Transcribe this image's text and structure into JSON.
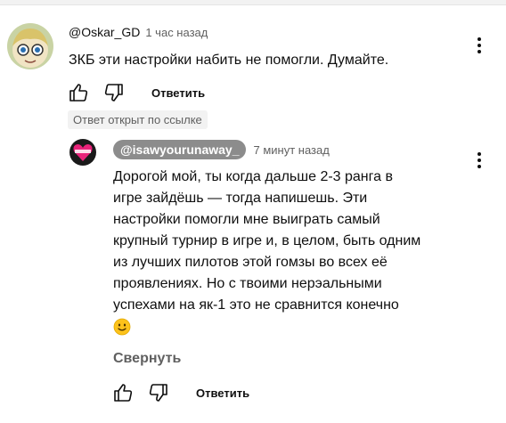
{
  "comment": {
    "author": "@Oskar_GD",
    "time": "1 час назад",
    "text": "ЗКБ эти настройки набить не помогли. Думайте.",
    "reply_label": "Ответить",
    "badge": "Ответ открыт по ссылке"
  },
  "reply": {
    "author": "@isawyourunaway_",
    "time": "7 минут назад",
    "lines": [
      "Дорогой мой, ты когда дальше 2-3 ранга в",
      "игре зайдёшь — тогда напишешь. Эти",
      "настройки помогли мне выиграть самый",
      "крупный турнир в игре и, в целом, быть одним",
      "из лучших пилотов этой гомзы во всех её",
      "проявлениях. Но с твоими нерэальными",
      "успехами на як-1 это не сравнится конечно"
    ],
    "emoji": "slightly-smiling-face",
    "collapse_label": "Свернуть",
    "reply_label": "Ответить"
  },
  "colors": {
    "text": "#0f0f0f",
    "secondary": "#606060",
    "pill": "#8c8c8c",
    "badge_bg": "#f2f2f2"
  }
}
